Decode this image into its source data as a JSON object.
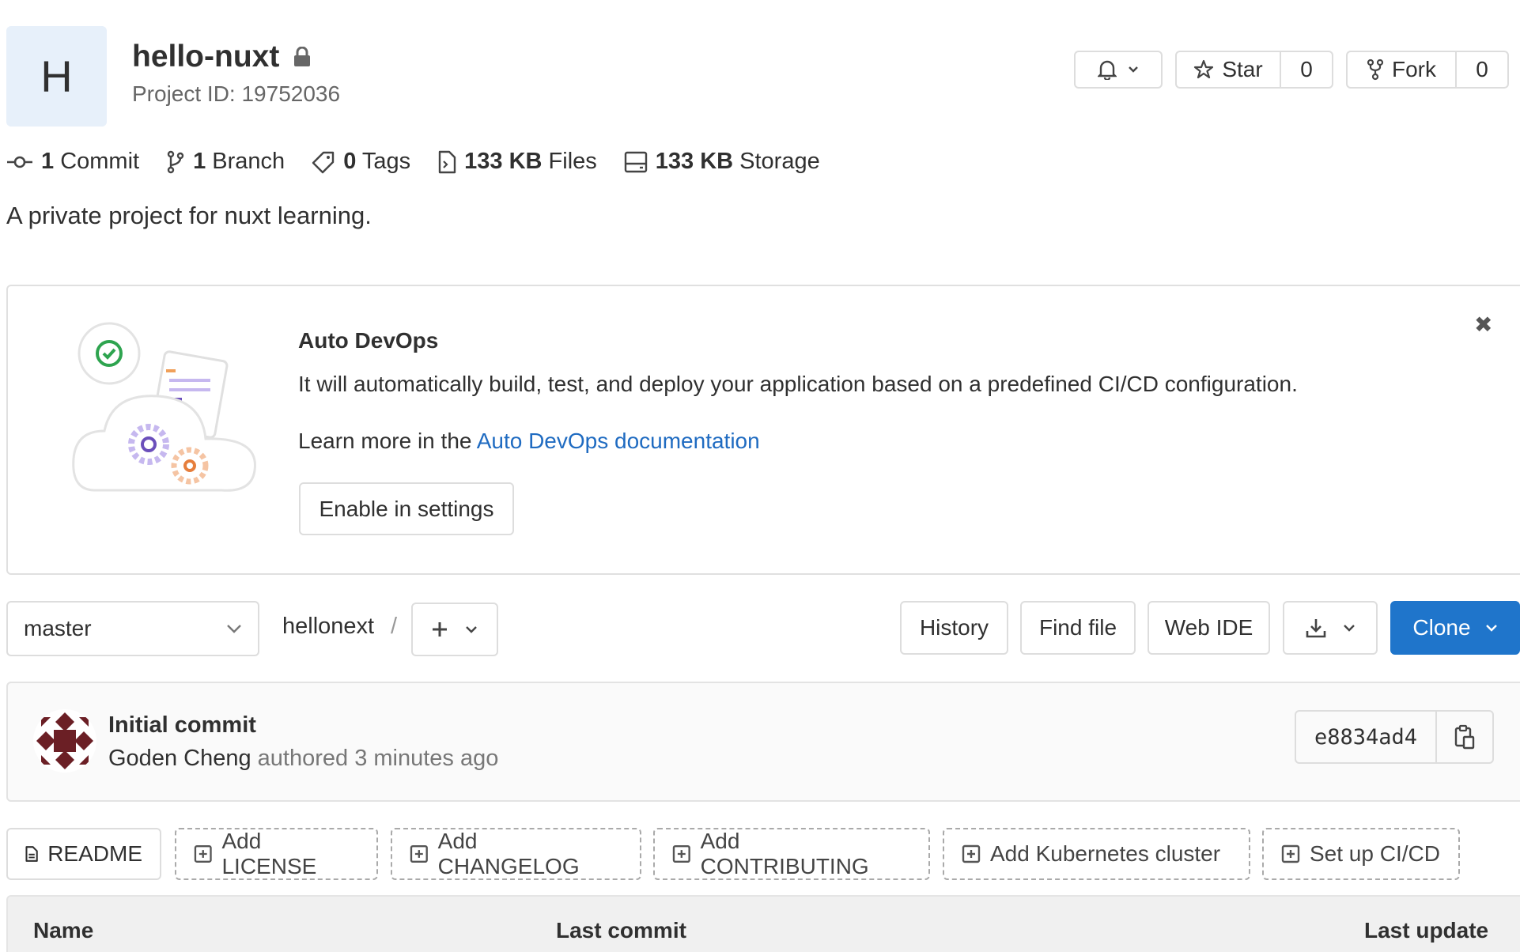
{
  "project": {
    "avatar_letter": "H",
    "name": "hello-nuxt",
    "id_label": "Project ID: 19752036",
    "description": "A private project for nuxt learning."
  },
  "header_actions": {
    "star_label": "Star",
    "star_count": "0",
    "fork_label": "Fork",
    "fork_count": "0"
  },
  "stats": [
    {
      "value": "1",
      "label": "Commit",
      "icon": "commit-icon"
    },
    {
      "value": "1",
      "label": "Branch",
      "icon": "branch-icon"
    },
    {
      "value": "0",
      "label": "Tags",
      "icon": "tag-icon"
    },
    {
      "value": "133 KB",
      "label": "Files",
      "icon": "file-icon"
    },
    {
      "value": "133 KB",
      "label": "Storage",
      "icon": "storage-icon"
    }
  ],
  "devops": {
    "title": "Auto DevOps",
    "text": "It will automatically build, test, and deploy your application based on a predefined CI/CD configuration.",
    "learn_prefix": "Learn more in the ",
    "learn_link": "Auto DevOps documentation",
    "enable_button": "Enable in settings"
  },
  "repo_bar": {
    "branch": "master",
    "path": "hellonext",
    "slash": "/",
    "history": "History",
    "find_file": "Find file",
    "web_ide": "Web IDE",
    "clone": "Clone"
  },
  "commit": {
    "title": "Initial commit",
    "author": "Goden Cheng",
    "meta": "authored 3 minutes ago",
    "sha": "e8834ad4"
  },
  "quick_links": [
    {
      "label": "README",
      "style": "solid"
    },
    {
      "label": "Add LICENSE",
      "style": "dashed"
    },
    {
      "label": "Add CHANGELOG",
      "style": "dashed"
    },
    {
      "label": "Add CONTRIBUTING",
      "style": "dashed"
    },
    {
      "label": "Add Kubernetes cluster",
      "style": "dashed"
    },
    {
      "label": "Set up CI/CD",
      "style": "dashed"
    }
  ],
  "table": {
    "col_name": "Name",
    "col_last_commit": "Last commit",
    "col_last_update": "Last update"
  },
  "colors": {
    "accent": "#1f75cb",
    "link": "#1f6bc1"
  }
}
